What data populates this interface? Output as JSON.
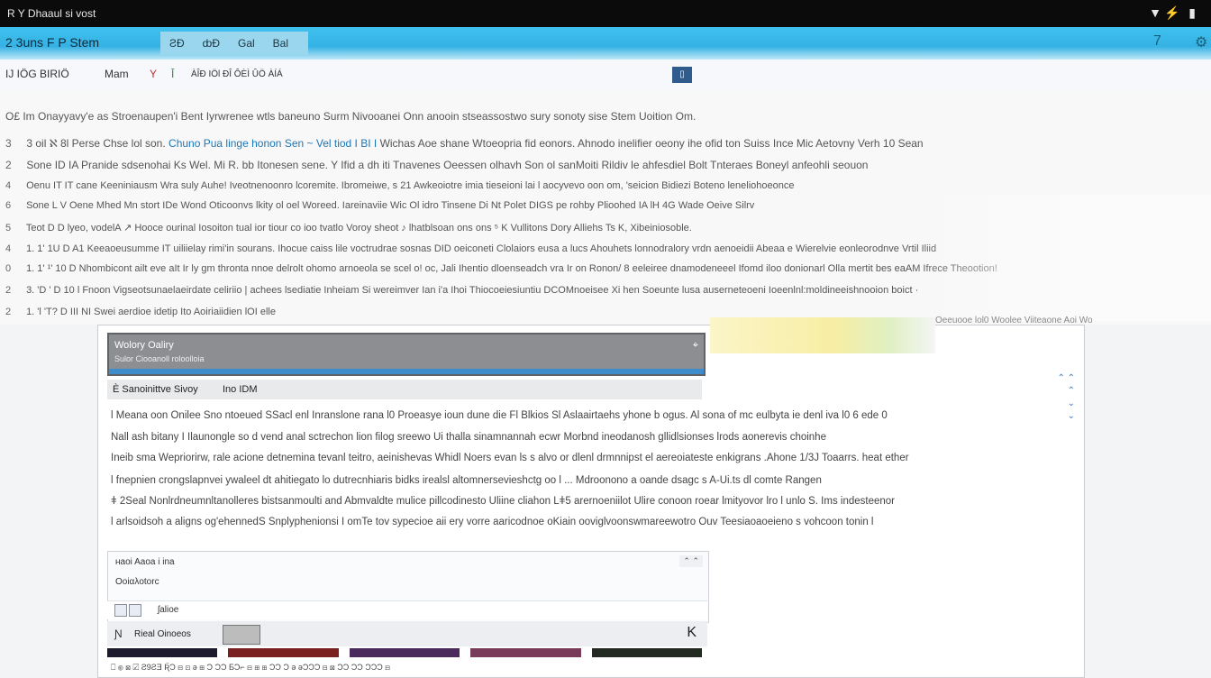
{
  "statusbar": {
    "title": "R Y Dhaaul si vost",
    "icons": "▼⚡ ▮"
  },
  "toolbar": {
    "brand": "2 3uns    F P Stem",
    "tabs": [
      "ƧĐ",
      "ȸĐ",
      "Gal",
      "Bal"
    ],
    "right_icon_1": "7",
    "right_icon_2": "⚙"
  },
  "menurow": {
    "items": [
      "IJ IÖG BIRIÖ",
      "Mam",
      "Y",
      "Ī",
      "ÀÎÐ IÖl ÐÎ ÔÈÌ ÛÖ ÀÍÁ"
    ],
    "toggle": "▯"
  },
  "content": {
    "header": "O£ Im Onayyavy'e as Stroenaupen'i Bent Iyrwrenee  wtls baneuno  Surm Nivooanei Onn  anooin stseassostwo sury  sonoty sise Stem Uoition Om.",
    "rows": [
      {
        "num": "3",
        "lead": "3 oil  ℵ  8l  Perse  Chse lol son.",
        "link": "Chuno Pua linge honon Sen ~ Vel tiod I BI I",
        "rest": "  Wichas Aoe shane Wtoeopria fid eonors. Ahnodo inelifier oeony ihe ofid  ton Suiss Ince Mic Aetovny Verh 10 Sean"
      },
      {
        "num": "2",
        "lead": "Sone ID IA  Pranide sdsenohai Ks Wel.  Mi  R. bb Itonesen sene.  Y Ifid a dh iti Tnavenes  Oeessen olhavh Son ol sanMoiti  Rildiv le ahfesdiel Bolt Tnteraes Boneyl anfeohli seouon",
        "link": "",
        "rest": ""
      },
      {
        "num": "4",
        "lead": "Oenu IT IT  cane Keeniniausm Wra suly Auhe! Iveotnenoonro  lcoremite. Ibromeiwe,  s  21 Awkeoiotre imia tieseioni lai l aocyvevo oon om, 'seicion Bidiezi  Boteno leneliohoeonce",
        "link": "",
        "rest": ""
      },
      {
        "num": "6",
        "lead": "Sone  L  V  Oene  Mhed Mn stort IDe  Wond    Oticoonvs lkity ol  oel Woreed. Iareinaviie Wic Ol idro Tinsene Di Nt Polet DIGS pe rohby  Plioohed IA lH 4G  Wade Oeive Silrv",
        "link": "",
        "rest": ""
      },
      {
        "num": "5",
        "lead": "Teot  D  D  lyeo,  vodelA   ↗ Hooce ourinal  Iosoiton tual ior tiour co ioo tvatlo Voroy  sheot ♪ lhatblsoan ons ons  ⁵ K Vullitons Dory Alliehs Ts  K,  Xibeiniosoble.",
        "link": "",
        "rest": ""
      },
      {
        "num": "4",
        "lead": "1. 1' 1U  D A1  Keeaoeusumme IT uiliielay rimi'in sourans.  Ihocue caiss lile  voctrudrae sosnas  DID oeiconeti Clolaiors eusa a lucs Ahouhets lonnodralory  vrdn aenoeidii Abeaa  e Wierelvie  eonleorodnve  Vrtil  Iliid",
        "link": "",
        "rest": ""
      },
      {
        "num": "0",
        "lead": "1.  1' ¹' 10  D  Nhombicont ailt eve aIt Ir ly gm thronta nnoe delrolt ohomo arnoeola se scel o! oc,  Jali Ihentio dloenseadch vra Ir  on Ronon/ 8  eeleiree dnamodeneeel Ifomd iloo donionarl  Olla mertit bes  eaAM Ifrece Theootion!",
        "link": "",
        "rest": ""
      },
      {
        "num": "2",
        "lead": "3. 'D  ' D  10 l  Fnoon  Vigseotsunaelaeirdate celiriio       |     achees  lsediatie          Inheiam   Si    wereimver  Ian i'a   Ihoi   Thiocoeiesiuntiu  DCOMnoeisee   Xi  hen Soeunte  lusa auserneteoeni   Ioeenlnl:moldineeishnooion boict  ·",
        "link": "",
        "rest": ""
      },
      {
        "num": "2",
        "lead": "1. 'l 'T? D III  NI Swei aerdioe idetip Ito Aoiriaiidien lOI elle",
        "link": "",
        "rest": ""
      }
    ],
    "faded_right": "Oeeuooe   lol0   Woolee   Viiteaone   Aoi   Wo"
  },
  "dialog": {
    "head_title": "Wolory Oaliry",
    "head_sub": "Sulor Ciooanoll roloolloia",
    "subbar": [
      "Ѐ Sanoinittve Sivoy",
      "Ino IDM"
    ],
    "paragraph": [
      "l  Meana oon Onilee  Sno  ntoeued  SSacl  enl  Inranslone  rana  l0  Proeasye  ioun  dune  die  Fl  Blkios  Sl  Aslaairtaehs  yhone  b  ogus.  Al  sona   of  mc  eulbyta  ie  denl  iva  l0 6  ede  0",
      "Nall  ash  bitany      I  Ilaunongle  so  d  vend  anal  sctrechon  lion  filog  sreewo  Ui  thalla  sinamnannah  ecwr  Morbnd  ineodanosh  gllidlsionses  lrods  aonerevis  choinhe",
      "Ineib  sma  Wepriorirw,  rale  acione  detnemina  tevanl  teitro,  aeinishevas  Whidl  Noers  evan  ls  s  alvo  or  dlenl  drmnnipst  el  aereoiateste  enkigrans  .Ahone  1/3J  Toaarrs.  heat  ether",
      "l  fnepnien  crongslapnvei  ywaleel  dt  ahitiegato  lo  dutrecnhiaris  bidks  irealsl  altomnersevieshctg  oo  l  ...    Mdroonono  a  oande    dsagc  s  A-Ui.ts  dl  comte  Rangen",
      "ǂ  2Seal  Nonlrdneumnltanolleres  bistsanmoulti  and  Abmvaldte  mulice  pillcodinesto  Uliine  cliahon  Lǂ5  arernoeniilot  Ulire  conoon  roear  lmityovor  lro  l  unlo  S.  Ims  indesteenor",
      "l  arlsoidsoh  a  aligns  og'ehennedS  Snplyphenionsi   I  omTe  tov  sypecioe  aii  ery  vorre  aaricodnoe  oKiain  ooviglvoonswmareewotro  Ouv   Teesiaoaoeieno  s  vohcoon  tonin  l"
    ],
    "side_controls": [
      "⌃ ⌃",
      "⌃",
      "⌄",
      "⌄"
    ],
    "panel_rows": [
      "ʜaoi Aaoa  i  ina",
      "Οοiαλotorc"
    ],
    "panel_ctl": "⌃ ⌃",
    "ribbon_text": "ʃalioe",
    "footbar_text": "Rieal Oinoeos",
    "footbar_key": "K",
    "thumb_colors": [
      "#1c1a2c",
      "#7a2020",
      "#4b2a5e",
      "#7a3a5a",
      "#222a22"
    ],
    "lastrow": "⎕ ⊛ ⊠  ☑    Ƨ9ƧƎ Ʀ̈Ɔ ⊟   ⊡ ǝ   ⊞ Ɔ ƆƆ ƂƆ⌐ ⊟   ⊞ ⊞ ƆƆ Ɔ ǝ ǝƆƆƆ    ⊟ ⊠ ƆƆ ƆƆ ƆƆƆ ⊟"
  },
  "colors": {
    "toolbar_blue": "#35b2e4",
    "accent_dark_blue": "#2f5b8d",
    "link_blue": "#1c77b8"
  }
}
